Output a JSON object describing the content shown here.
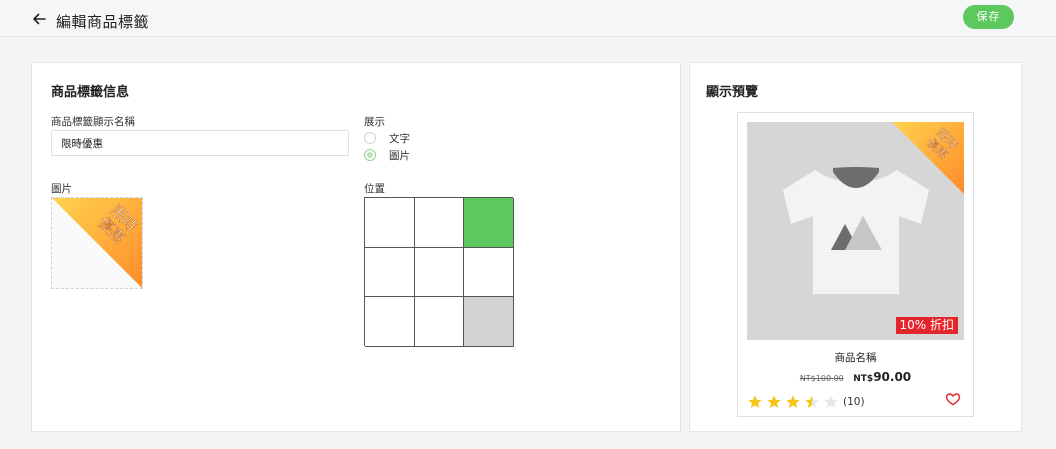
{
  "header": {
    "title": "編輯商品標籤",
    "save_label": "保存",
    "back_icon": "arrow-left-icon"
  },
  "colors": {
    "accent": "#5cc85e",
    "selected_cell": "#5cc85e",
    "disabled_cell": "#d3d3d3",
    "discount_badge": "#e4262c",
    "star": "#f5c518"
  },
  "tag_info": {
    "title": "商品標籤信息",
    "name_label": "商品標籤顯示名稱",
    "name_value": "限時優惠",
    "display_label": "展示",
    "display_options": [
      {
        "label": "文字",
        "selected": false
      },
      {
        "label": "圖片",
        "selected": true
      }
    ],
    "image_label": "圖片",
    "ribbon_text_line1": "限時",
    "ribbon_text_line2": "優惠",
    "position_label": "位置",
    "position_grid": [
      [
        "empty",
        "empty",
        "selected"
      ],
      [
        "empty",
        "empty",
        "empty"
      ],
      [
        "empty",
        "empty",
        "disabled"
      ]
    ]
  },
  "preview": {
    "title": "顯示預覽",
    "product_name": "商品名稱",
    "old_price": "NT$100.00",
    "new_price_prefix": "NT$",
    "new_price_value": "90.00",
    "discount_label": "10% 折扣",
    "rating": 3.5,
    "review_count": "(10)",
    "ribbon_text_line1": "限時",
    "ribbon_text_line2": "優惠"
  }
}
